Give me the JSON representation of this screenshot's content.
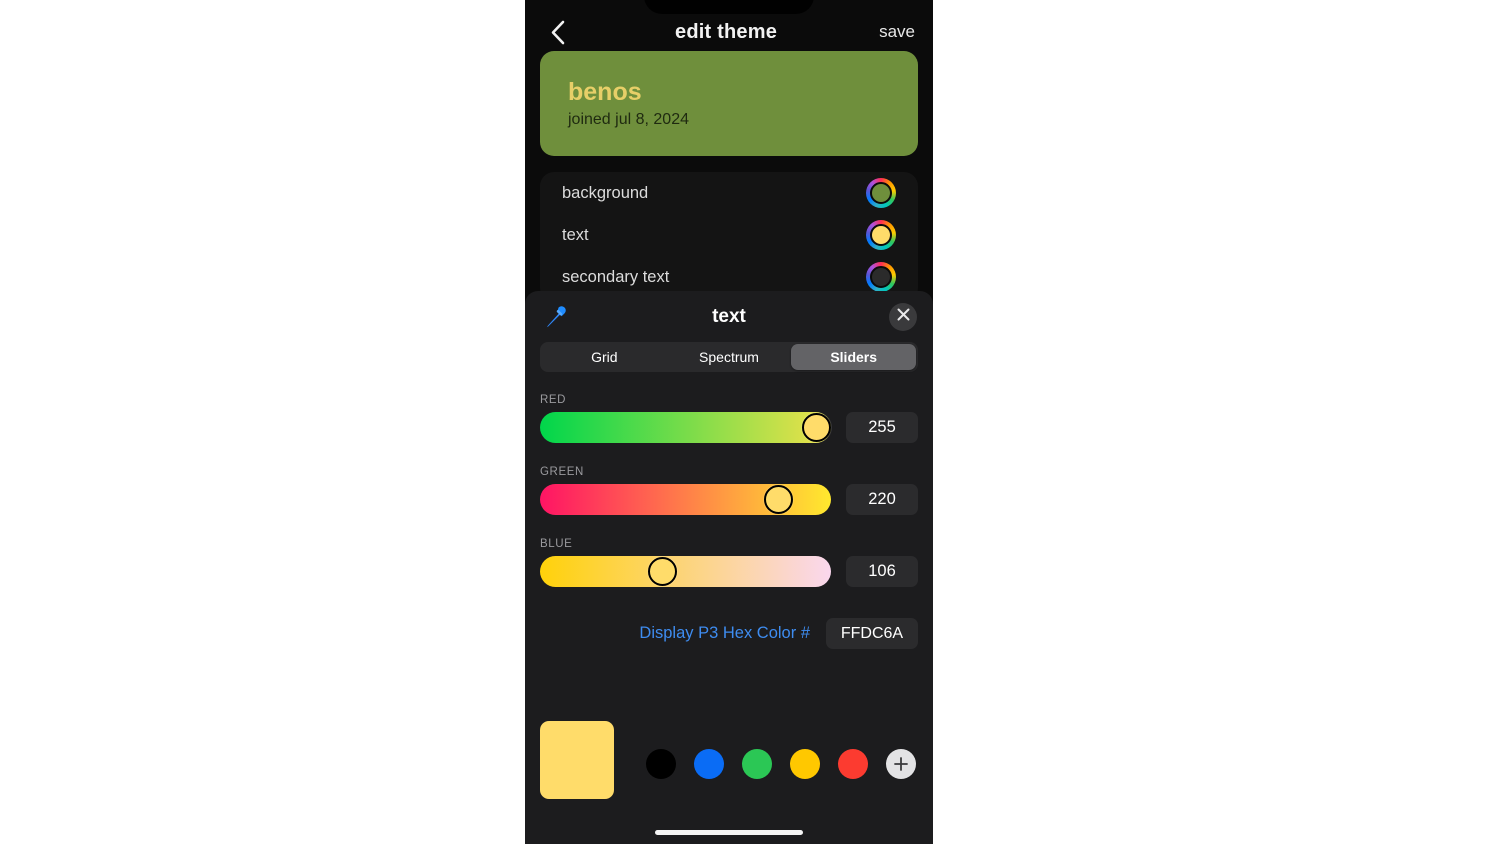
{
  "nav": {
    "back_icon": "chevron-left-icon",
    "title": "edit theme",
    "save_label": "save"
  },
  "profile": {
    "name": "benos",
    "joined": "joined jul 8, 2024",
    "card_color": "#6F8F3C",
    "name_color": "#E7CF68",
    "joined_color": "#1F2A10"
  },
  "color_rows": [
    {
      "label": "background",
      "swatch": "#6F8F3C"
    },
    {
      "label": "text",
      "swatch": "#FFDC6A"
    },
    {
      "label": "secondary text",
      "swatch": "#2B2B2B"
    }
  ],
  "picker": {
    "eyedropper_icon": "eyedropper-icon",
    "title": "text",
    "close_icon": "close-icon",
    "tabs": [
      {
        "label": "Grid",
        "active": false
      },
      {
        "label": "Spectrum",
        "active": false
      },
      {
        "label": "Sliders",
        "active": true
      }
    ],
    "sliders": [
      {
        "label": "RED",
        "value": "255",
        "percent": 100,
        "gradient_from": "#00D64B",
        "gradient_to": "#F0E24A"
      },
      {
        "label": "GREEN",
        "value": "220",
        "percent": 82,
        "gradient_from": "#FF1464",
        "gradient_to": "#FFE92E"
      },
      {
        "label": "BLUE",
        "value": "106",
        "percent": 42,
        "gradient_from": "#FFD20A",
        "gradient_to": "#FAD7EE"
      }
    ],
    "thumb_color": "#FFDC6A",
    "hex_label": "Display P3 Hex Color #",
    "hex_value": "FFDC6A",
    "hex_label_color": "#3E8CF0",
    "preview_color": "#FFDC6A",
    "presets": [
      {
        "name": "preset-black",
        "color": "#000000"
      },
      {
        "name": "preset-blue",
        "color": "#0A6CF5"
      },
      {
        "name": "preset-green",
        "color": "#2BC755"
      },
      {
        "name": "preset-yellow",
        "color": "#FFC800"
      },
      {
        "name": "preset-red",
        "color": "#FC3B30"
      }
    ],
    "add_label": "+"
  }
}
